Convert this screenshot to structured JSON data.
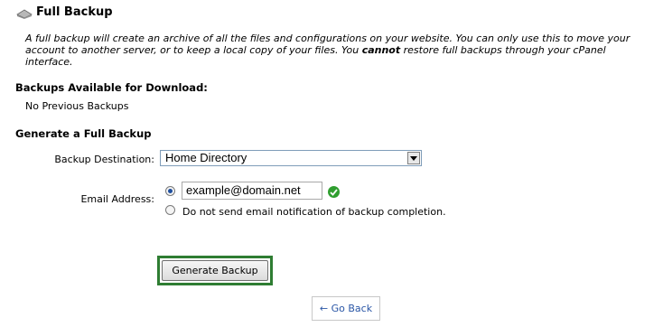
{
  "header": {
    "title": "Full Backup",
    "icon": "disk-icon"
  },
  "description": {
    "line1": "A full backup will create an archive of all the files and configurations on your website. You can only use this to move your",
    "line2_pre": "account to another server, or to keep a local copy of your files. You ",
    "line2_bold": "cannot",
    "line2_post": " restore full backups through your cPanel",
    "line3": "interface."
  },
  "backups_available": {
    "heading": "Backups Available for Download:",
    "status": "No Previous Backups"
  },
  "generate": {
    "heading": "Generate a Full Backup",
    "destination_label": "Backup Destination:",
    "destination_value": "Home Directory",
    "email_label": "Email Address:",
    "email_value": "example@domain.net",
    "email_option_selected": "email",
    "no_email_label": "Do not send email notification of backup completion.",
    "generate_button": "Generate Backup",
    "back_link": "← Go Back"
  },
  "colors": {
    "accent_outline": "#2e7d32",
    "valid_check": "#2f9e2f",
    "link": "#2a56a6"
  }
}
